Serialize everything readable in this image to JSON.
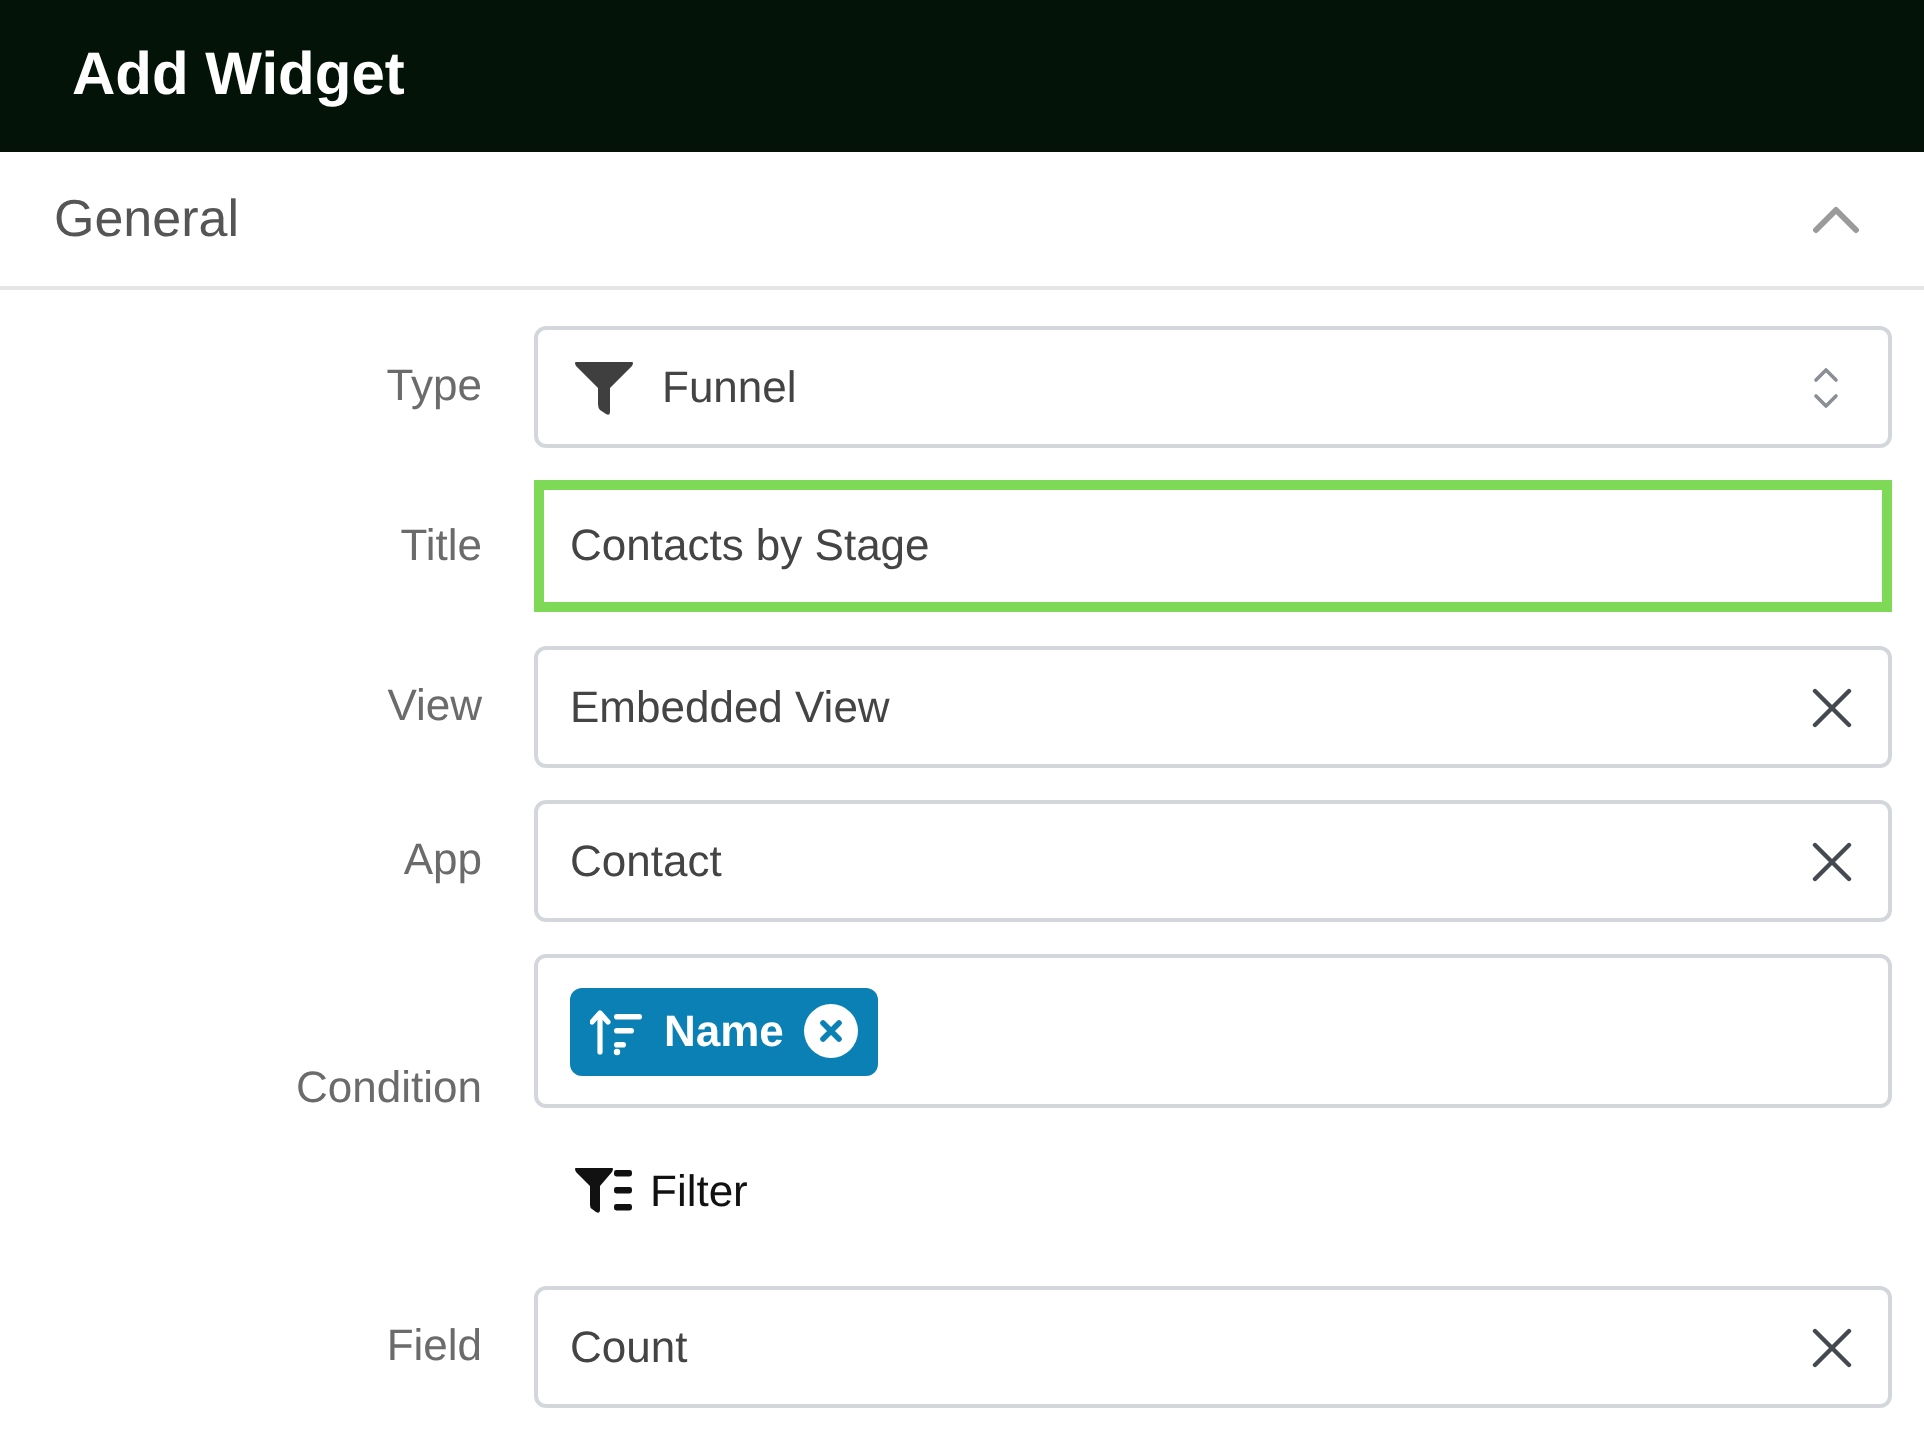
{
  "header": {
    "title": "Add Widget"
  },
  "section": {
    "title": "General",
    "expanded": true
  },
  "fields": [
    {
      "kind": "select",
      "label": "Type",
      "value": "Funnel",
      "focused": false
    },
    {
      "kind": "text",
      "label": "Title",
      "value": "Contacts by Stage",
      "focused": true
    },
    {
      "kind": "clearable",
      "label": "View",
      "value": "Embedded View",
      "focused": false
    },
    {
      "kind": "clearable",
      "label": "App",
      "value": "Contact",
      "focused": false
    },
    {
      "kind": "condition",
      "label": "Condition",
      "tags": [
        {
          "label": "Name"
        }
      ],
      "filter_link": "Filter",
      "focused": false
    },
    {
      "kind": "clearable",
      "label": "Field",
      "value": "Count",
      "focused": false
    }
  ]
}
